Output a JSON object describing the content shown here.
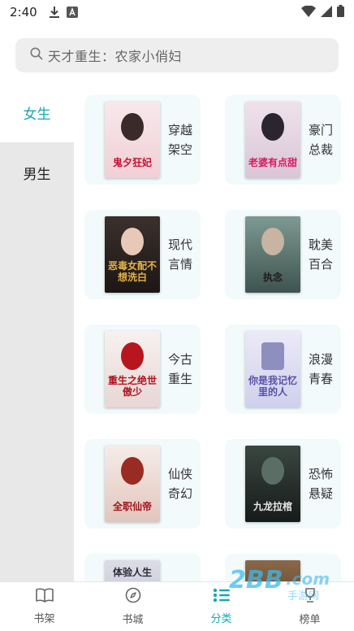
{
  "status_bar": {
    "time": "2:40"
  },
  "search": {
    "placeholder": "天才重生：农家小俏妇"
  },
  "sidebar": {
    "items": [
      {
        "label": "女生",
        "active": true
      },
      {
        "label": "男生",
        "active": false
      }
    ]
  },
  "categories": [
    {
      "label_line1": "穿越",
      "label_line2": "架空",
      "cover_title": "鬼夕狂妃",
      "cover_color": "#f4dfe2"
    },
    {
      "label_line1": "豪门",
      "label_line2": "总裁",
      "cover_title": "老婆有点甜",
      "cover_color": "#e9dce6"
    },
    {
      "label_line1": "现代",
      "label_line2": "言情",
      "cover_title": "恶毒女配不想洗白",
      "cover_color": "#2a2320"
    },
    {
      "label_line1": "耽美",
      "label_line2": "百合",
      "cover_title": "执念",
      "cover_color": "#5d7a74"
    },
    {
      "label_line1": "今古",
      "label_line2": "重生",
      "cover_title": "重生之绝世傲少",
      "cover_color": "#f3eceb"
    },
    {
      "label_line1": "浪漫",
      "label_line2": "青春",
      "cover_title": "你是我记忆里的人",
      "cover_color": "#dfe0f2"
    },
    {
      "label_line1": "仙侠",
      "label_line2": "奇幻",
      "cover_title": "全职仙帝",
      "cover_color": "#f1e4df"
    },
    {
      "label_line1": "恐怖",
      "label_line2": "悬疑",
      "cover_title": "九龙拉棺",
      "cover_color": "#27302c"
    },
    {
      "label_line1": "",
      "label_line2": "",
      "cover_title": "体验人生",
      "cover_color": "#d9dbe4"
    },
    {
      "label_line1": "",
      "label_line2": "",
      "cover_title": "",
      "cover_color": "#7a5a3e"
    }
  ],
  "bottom_nav": {
    "items": [
      {
        "label": "书架",
        "icon": "book-icon",
        "active": false
      },
      {
        "label": "书城",
        "icon": "compass-icon",
        "active": false
      },
      {
        "label": "分类",
        "icon": "list-icon",
        "active": true
      },
      {
        "label": "榜单",
        "icon": "trophy-icon",
        "active": false
      }
    ]
  },
  "colors": {
    "accent": "#17a7b5",
    "sidebar_bg": "#e8e8e8",
    "card_bg": "#f2fafb"
  },
  "watermark": {
    "text": "2BB.com",
    "sub": "手游网"
  }
}
